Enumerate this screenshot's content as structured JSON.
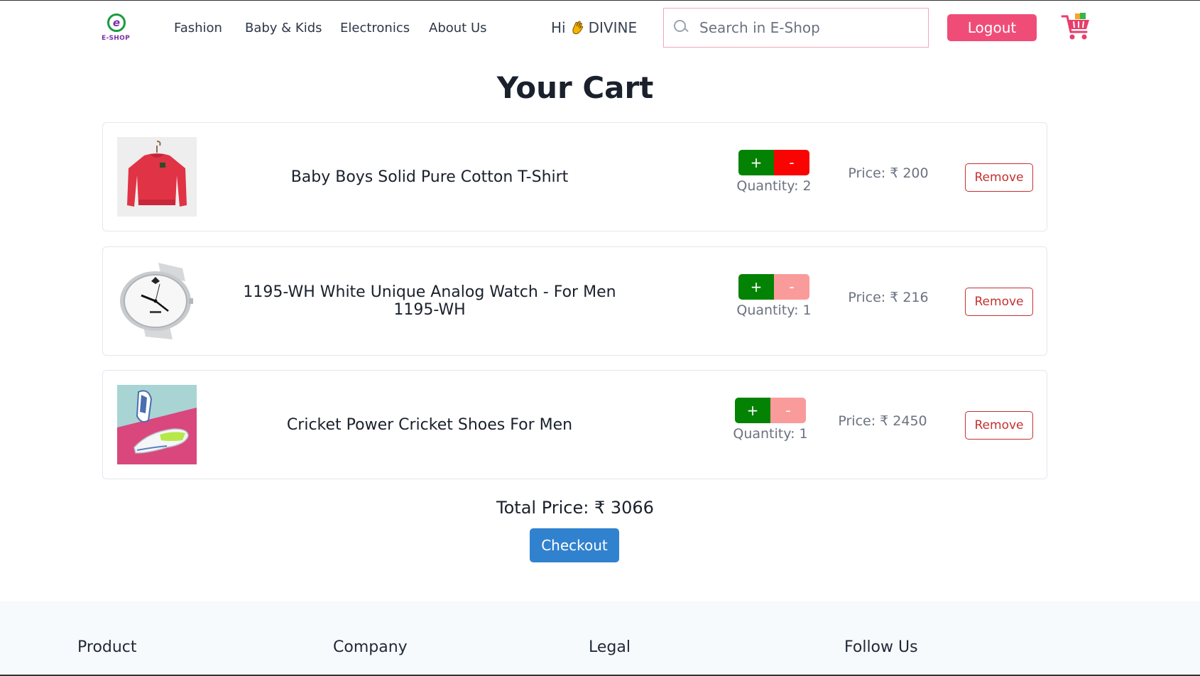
{
  "header": {
    "logo_text": "E-SHOP",
    "logo_letter": "e",
    "nav": [
      "Fashion",
      "Baby & Kids",
      "Electronics",
      "About Us"
    ],
    "greeting_prefix": "Hi",
    "greeting_icon": "waving-hand-icon",
    "user_name": "DIVINE",
    "search_placeholder": "Search in E-Shop",
    "search_value": "",
    "logout_label": "Logout",
    "cart_icon": "shopping-cart-icon"
  },
  "page_title": "Your Cart",
  "cart": {
    "items": [
      {
        "name": "Baby Boys Solid Pure Cotton T-Shirt",
        "quantity_label": "Quantity: 2",
        "price_label": "Price: ₹ 200",
        "image": "red-tshirt-image",
        "minus_disabled": false
      },
      {
        "name": "1195-WH White Unique Analog Watch - For Men 1195-WH",
        "quantity_label": "Quantity: 1",
        "price_label": "Price: ₹ 216",
        "image": "white-watch-image",
        "minus_disabled": true
      },
      {
        "name": "Cricket Power Cricket Shoes For Men",
        "quantity_label": "Quantity: 1",
        "price_label": "Price: ₹ 2450",
        "image": "cricket-shoes-image",
        "minus_disabled": true
      }
    ],
    "plus_label": "+",
    "minus_label": "-",
    "remove_label": "Remove",
    "total_label": "Total Price: ₹ 3066",
    "checkout_label": "Checkout"
  },
  "footer": {
    "columns": [
      "Product",
      "Company",
      "Legal",
      "Follow Us"
    ]
  },
  "colors": {
    "accent_pink": "#ef4d78",
    "plus_green": "#048204",
    "minus_red": "#f90303",
    "minus_disabled": "#fa9b9b",
    "remove_red": "#c53030",
    "checkout_blue": "#3182ce"
  }
}
